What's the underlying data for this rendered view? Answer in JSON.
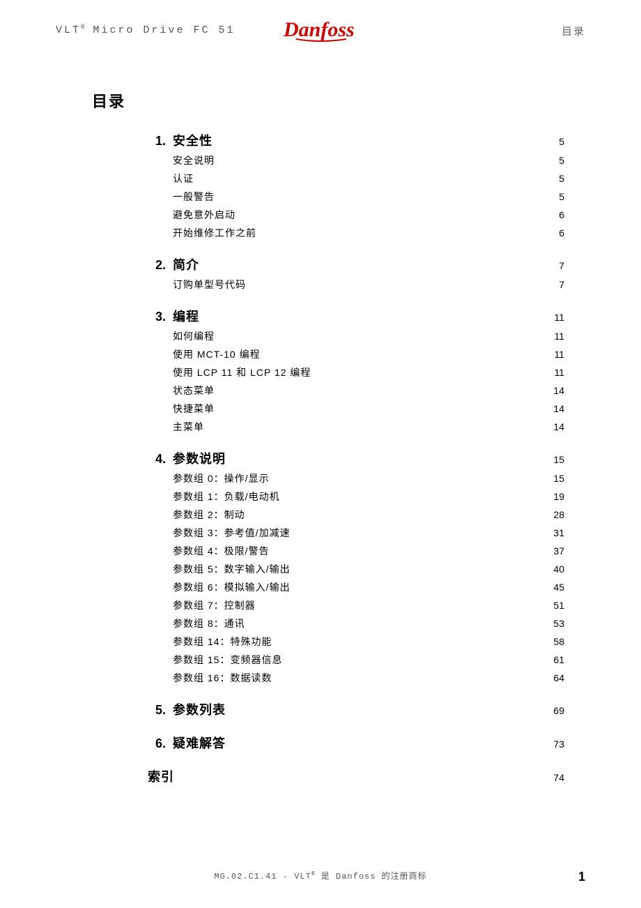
{
  "header": {
    "left_pre": "VLT",
    "left_sup": "®",
    "left_post": " Micro Drive FC 51",
    "right": "目录",
    "logo_alt": "Danfoss"
  },
  "toc_title": "目录",
  "sections": [
    {
      "num": "1.",
      "name": "安全性",
      "page": "5",
      "subs": [
        {
          "name": "安全说明",
          "page": "5"
        },
        {
          "name": "认证",
          "page": "5"
        },
        {
          "name": "一般警告",
          "page": "5"
        },
        {
          "name": "避免意外启动",
          "page": "6"
        },
        {
          "name": "开始维修工作之前",
          "page": "6"
        }
      ]
    },
    {
      "num": "2.",
      "name": "简介",
      "page": "7",
      "subs": [
        {
          "name": "订购单型号代码",
          "page": "7"
        }
      ]
    },
    {
      "num": "3.",
      "name": "编程",
      "page": "11",
      "subs": [
        {
          "name": "如何编程",
          "page": "11"
        },
        {
          "name": "使用 MCT-10 编程",
          "page": "11"
        },
        {
          "name": "使用 LCP 11 和 LCP 12 编程",
          "page": "11"
        },
        {
          "name": "状态菜单",
          "page": "14"
        },
        {
          "name": "快捷菜单",
          "page": "14"
        },
        {
          "name": "主菜单",
          "page": "14"
        }
      ]
    },
    {
      "num": "4.",
      "name": "参数说明",
      "page": "15",
      "subs": [
        {
          "name": "参数组 0：操作/显示",
          "page": "15"
        },
        {
          "name": "参数组 1：负载/电动机",
          "page": "19"
        },
        {
          "name": "参数组 2：制动",
          "page": "28"
        },
        {
          "name": "参数组 3：参考值/加减速",
          "page": "31"
        },
        {
          "name": "参数组 4：极限/警告",
          "page": "37"
        },
        {
          "name": "参数组 5：数字输入/输出",
          "page": "40"
        },
        {
          "name": "参数组 6：模拟输入/输出",
          "page": "45"
        },
        {
          "name": "参数组 7：控制器",
          "page": "51"
        },
        {
          "name": "参数组 8：通讯",
          "page": "53"
        },
        {
          "name": "参数组 14：特殊功能",
          "page": "58"
        },
        {
          "name": "参数组 15：变频器信息",
          "page": "61"
        },
        {
          "name": "参数组 16：数据读数",
          "page": "64"
        }
      ]
    },
    {
      "num": "5.",
      "name": "参数列表",
      "page": "69",
      "subs": []
    },
    {
      "num": "6.",
      "name": "疑难解答",
      "page": "73",
      "subs": []
    },
    {
      "num": "",
      "name": "索引",
      "page": "74",
      "subs": [],
      "index": true
    }
  ],
  "footer": {
    "line_pre": "MG.02.C1.41 - VLT",
    "line_sup": "®",
    "line_post": " 是 Danfoss 的注册商标",
    "pageno": "1"
  }
}
